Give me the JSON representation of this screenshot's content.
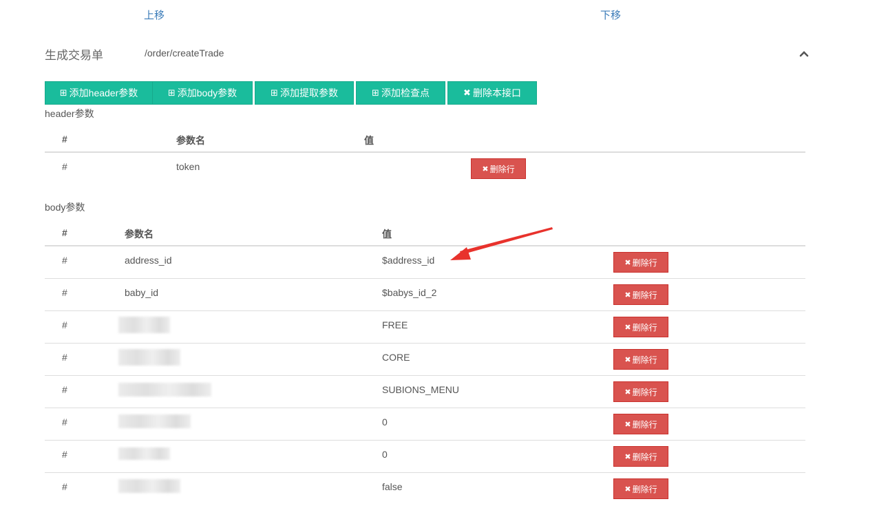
{
  "nav": {
    "move_up": "上移",
    "move_down": "下移"
  },
  "api": {
    "name": "生成交易单",
    "path": "/order/createTrade"
  },
  "toolbar": {
    "add_header": "添加header参数",
    "add_body": "添加body参数",
    "add_extract": "添加提取参数",
    "add_checkpoint": "添加检查点",
    "delete_api": "删除本接口"
  },
  "header_section": {
    "label": "header参数",
    "columns": {
      "index": "#",
      "name": "参数名",
      "value": "值"
    },
    "rows": [
      {
        "index": "#",
        "name": "token",
        "value": "",
        "action": "删除行"
      }
    ]
  },
  "body_section": {
    "label": "body参数",
    "columns": {
      "index": "#",
      "name": "参数名",
      "value": "值"
    },
    "rows": [
      {
        "index": "#",
        "name": "address_id",
        "value": "$address_id",
        "action": "删除行"
      },
      {
        "index": "#",
        "name": "baby_id",
        "value": "$babys_id_2",
        "action": "删除行"
      },
      {
        "index": "#",
        "name": "",
        "value": "FREE",
        "action": "删除行"
      },
      {
        "index": "#",
        "name": "",
        "value": "CORE",
        "action": "删除行"
      },
      {
        "index": "#",
        "name": "",
        "value": "SUBIONS_MENU",
        "action": "删除行"
      },
      {
        "index": "#",
        "name": "",
        "value": "0",
        "action": "删除行"
      },
      {
        "index": "#",
        "name": "",
        "value": "0",
        "action": "删除行"
      },
      {
        "index": "#",
        "name": "",
        "value": "false",
        "action": "删除行"
      }
    ]
  },
  "colors": {
    "teal": "#1abc9c",
    "danger": "#d9534f",
    "link": "#3a7bb8",
    "arrow": "#e8322c"
  }
}
